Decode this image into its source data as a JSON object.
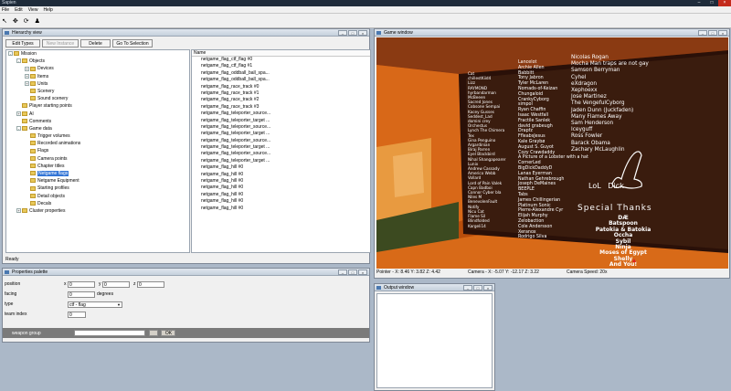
{
  "app": {
    "title": "Sapien"
  },
  "menu": [
    "File",
    "Edit",
    "View",
    "Help"
  ],
  "hierarchy": {
    "title": "Hierarchy view",
    "buttons": {
      "edit_types": "Edit Types",
      "new_instance": "New Instance",
      "delete": "Delete",
      "go_to_selection": "Go To Selection"
    },
    "tree": [
      {
        "label": "Mission",
        "level": 0,
        "exp": "-"
      },
      {
        "label": "Objects",
        "level": 1,
        "exp": "-"
      },
      {
        "label": "Devices",
        "level": 2,
        "exp": "+"
      },
      {
        "label": "Items",
        "level": 2,
        "exp": "+"
      },
      {
        "label": "Units",
        "level": 2,
        "exp": "+"
      },
      {
        "label": "Scenery",
        "level": 2,
        "exp": ""
      },
      {
        "label": "Sound scenery",
        "level": 2,
        "exp": ""
      },
      {
        "label": "Player starting points",
        "level": 1,
        "exp": ""
      },
      {
        "label": "AI",
        "level": 1,
        "exp": "+"
      },
      {
        "label": "Comments",
        "level": 1,
        "exp": ""
      },
      {
        "label": "Game data",
        "level": 1,
        "exp": "-"
      },
      {
        "label": "Trigger volumes",
        "level": 2,
        "exp": ""
      },
      {
        "label": "Recorded animations",
        "level": 2,
        "exp": ""
      },
      {
        "label": "Flags",
        "level": 2,
        "exp": ""
      },
      {
        "label": "Camera points",
        "level": 2,
        "exp": ""
      },
      {
        "label": "Chapter titles",
        "level": 2,
        "exp": ""
      },
      {
        "label": "Netgame flags",
        "level": 2,
        "exp": "",
        "selected": true
      },
      {
        "label": "Netgame Equipment",
        "level": 2,
        "exp": ""
      },
      {
        "label": "Starting profiles",
        "level": 2,
        "exp": ""
      },
      {
        "label": "Detail objects",
        "level": 2,
        "exp": ""
      },
      {
        "label": "Decals",
        "level": 2,
        "exp": ""
      },
      {
        "label": "Cluster properties",
        "level": 1,
        "exp": "+"
      }
    ],
    "list_header": "Name",
    "list": [
      "netgame_flag_ctf_flag #0",
      "netgame_flag_ctf_flag #1",
      "netgame_flag_oddball_ball_spa...",
      "netgame_flag_oddball_ball_spa...",
      "netgame_flag_race_track #0",
      "netgame_flag_race_track #1",
      "netgame_flag_race_track #2",
      "netgame_flag_race_track #3",
      "netgame_flag_teleporter_source...",
      "netgame_flag_teleporter_target ...",
      "netgame_flag_teleporter_source...",
      "netgame_flag_teleporter_target ...",
      "netgame_flag_teleporter_source...",
      "netgame_flag_teleporter_target ...",
      "netgame_flag_teleporter_source...",
      "netgame_flag_teleporter_target ...",
      "netgame_flag_hill #0",
      "netgame_flag_hill #0",
      "netgame_flag_hill #0",
      "netgame_flag_hill #0",
      "netgame_flag_hill #0",
      "netgame_flag_hill #0",
      "netgame_flag_hill #0"
    ],
    "status": "Ready"
  },
  "properties": {
    "title": "Properties palette",
    "position_label": "position",
    "x_label": "x",
    "y_label": "y",
    "z_label": "z",
    "x": "0",
    "y": "0",
    "z": "0",
    "facing_label": "facing",
    "facing": "0",
    "facing_unit": "degrees",
    "type_label": "type",
    "type_value": "ctf - flag",
    "team_label": "team index",
    "team": "0",
    "weapon_group_label": "weapon group",
    "ok_label": "OK"
  },
  "game_window": {
    "title": "Game window",
    "pointer": "Pointer - X: 8.46 Y: 3.82 Z: 4.42",
    "camera": "Camera - X: -5.07 Y: -12.17 Z: 3.22",
    "speed": "Camera Speed: 20x",
    "credits_col1": "Cat\nchillestKiid4\nLizz\nRAYMOND\nhyrbandarman\nMcBeeen\nSacred Jones\nCobsone Sempai\nKacey Gusses\nSeddest_Lad\ndomini crey\nOrchestus\nLynch The Chimera\nTex\nGina Penguino\nArgardinian\nBiraj Parren\nEyel Blackbird\nNihal Shangapearer\nLunix\nAndrew Cassady\nAmerico Webb\nVollard\nLord of Pain Valek\nCapn Badboi\nConnor Cyber bla\nNiles M\nBenevolenFault\nNotify\nNicu Cat\nFlame Sil\nBlindfolded\nKargeli14",
    "credits_col2": "Lancelot\nArchie Allen\nBabbitt\nTony Jabron\nTyler McLaren\nNomads-of-Keizan\nChungaloid\nCrankyCyborg\nsimpol\nRyan Chaffin\nIsaac Westfall\nFractile Sanlek\ndavid grabeugh\nDrapfz\nFfleabsJesus\nKale Graybø\nAugust S. Guyot\nCozy Crawdaddy\nA Picture of a Lobster with a hat\nCornerLed\nBigDickDaddyD\nLanas Eyerman\nNathan Gehrebrough\nJoseph DeMaines\nBEEPLE\nTabs\nJames Chillingerian\nPlatinum Sonic\nPierre-Alexandre Cyr\nElijah Murphy\nZelobaction\nCole Andersson\nXeranox\nRodrigo Silva",
    "credits_col3": "Nicolas Rogan\nMocha Man traps are not gay\nSamson Berryman\nCyhel\neXdragon\nXephoexx\nJose Martinez\nThe VengefulCyborg\nJaden Dunn (Juckfaden)\nMany Flames Away\nSam Henderson\nIceyguff\nRoss Fowler\nBarack Obama\nZachary McLaughlin",
    "doodle_text": "LoL   Dick",
    "special_title": "Special Thanks",
    "special": [
      "DÆ",
      "Batspoon",
      "Patokia & Batokia",
      "Occha",
      "Sybil",
      "Ninja",
      "Moses of Egypt",
      "Shelly",
      "And You!"
    ]
  },
  "output": {
    "title": "Output window"
  }
}
